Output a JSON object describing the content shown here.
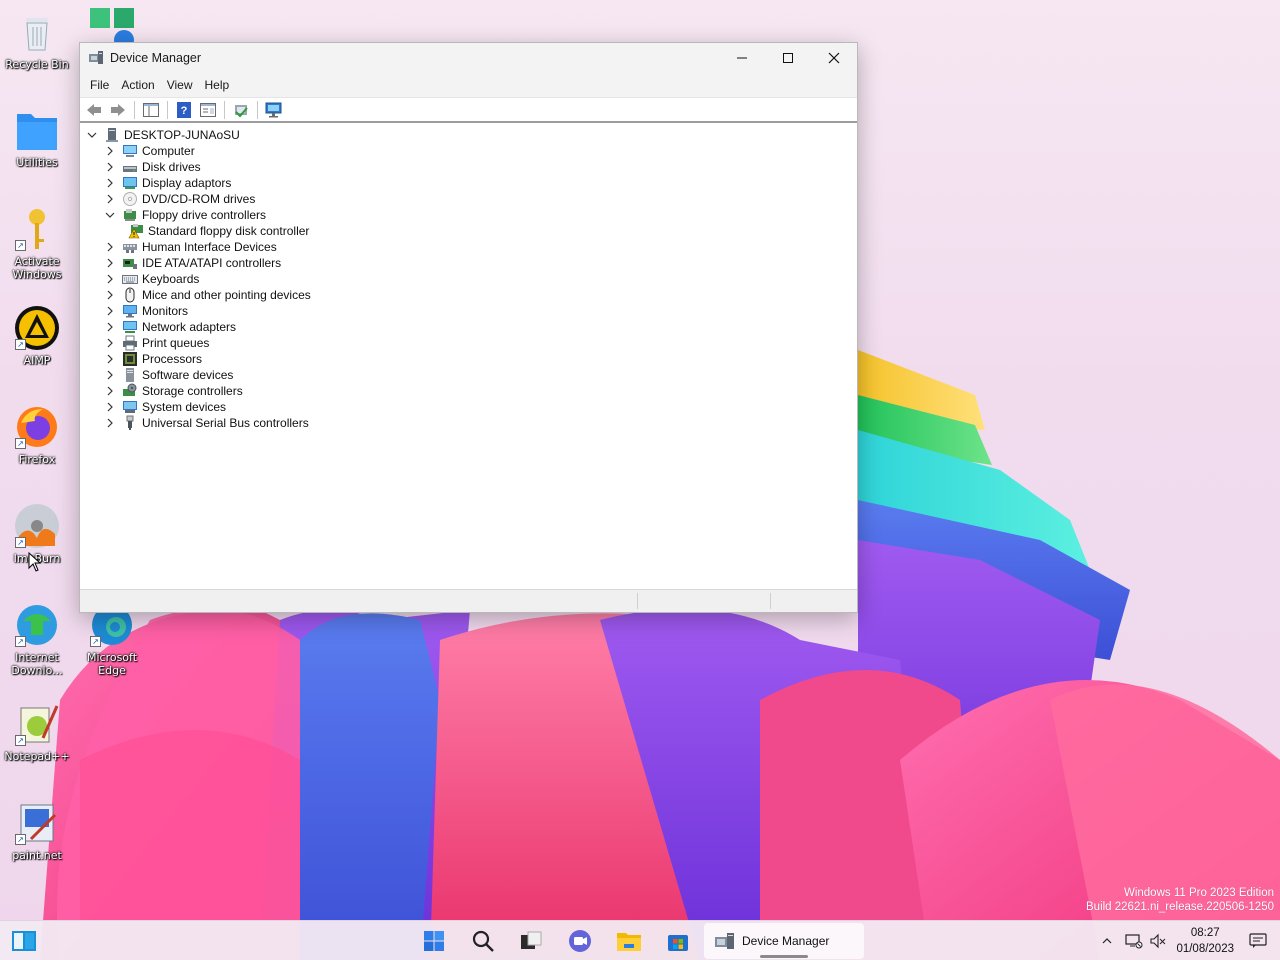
{
  "window": {
    "title": "Device Manager",
    "menu": [
      "File",
      "Action",
      "View",
      "Help"
    ],
    "controls": {
      "minimize": "—",
      "maximize": "☐",
      "close": "✕"
    }
  },
  "tree": {
    "root": "DESKTOP-JUNAoSU",
    "items": [
      {
        "label": "Computer",
        "icon": "computer-icon",
        "expanded": false
      },
      {
        "label": "Disk drives",
        "icon": "disk-drive-icon",
        "expanded": false
      },
      {
        "label": "Display adaptors",
        "icon": "display-adapter-icon",
        "expanded": false
      },
      {
        "label": "DVD/CD-ROM drives",
        "icon": "dvd-icon",
        "expanded": false
      },
      {
        "label": "Floppy drive controllers",
        "icon": "floppy-controller-icon",
        "expanded": true
      },
      {
        "label": "Standard floppy disk controller",
        "icon": "warning-device-icon",
        "child": true
      },
      {
        "label": "Human Interface Devices",
        "icon": "hid-icon",
        "expanded": false
      },
      {
        "label": "IDE ATA/ATAPI controllers",
        "icon": "ide-controller-icon",
        "expanded": false
      },
      {
        "label": "Keyboards",
        "icon": "keyboard-icon",
        "expanded": false
      },
      {
        "label": "Mice and other pointing devices",
        "icon": "mouse-icon",
        "expanded": false
      },
      {
        "label": "Monitors",
        "icon": "monitor-icon",
        "expanded": false
      },
      {
        "label": "Network adapters",
        "icon": "network-adapter-icon",
        "expanded": false
      },
      {
        "label": "Print queues",
        "icon": "printer-icon",
        "expanded": false
      },
      {
        "label": "Processors",
        "icon": "processor-icon",
        "expanded": false
      },
      {
        "label": "Software devices",
        "icon": "software-device-icon",
        "expanded": false
      },
      {
        "label": "Storage controllers",
        "icon": "storage-controller-icon",
        "expanded": false
      },
      {
        "label": "System devices",
        "icon": "system-device-icon",
        "expanded": false
      },
      {
        "label": "Universal Serial Bus controllers",
        "icon": "usb-icon",
        "expanded": false
      }
    ]
  },
  "desktop_icons": [
    {
      "label": "Recycle Bin"
    },
    {
      "label": "Utilities"
    },
    {
      "label": "Activate Windows"
    },
    {
      "label": "AIMP"
    },
    {
      "label": "Firefox"
    },
    {
      "label": "ImgBurn"
    },
    {
      "label": "Internet Downlo..."
    },
    {
      "label": "Microsoft Edge"
    },
    {
      "label": "Notepad++"
    },
    {
      "label": "paint.net"
    }
  ],
  "watermark": {
    "line1": "Windows 11 Pro 2023 Edition",
    "line2": "Build 22621.ni_release.220506-1250"
  },
  "taskbar": {
    "active_app": "Device Manager",
    "time": "08:27",
    "date": "01/08/2023"
  },
  "colors": {
    "accent": "#0067c0",
    "window_bg": "#ffffff",
    "titlebar": "#f3f3f3"
  }
}
